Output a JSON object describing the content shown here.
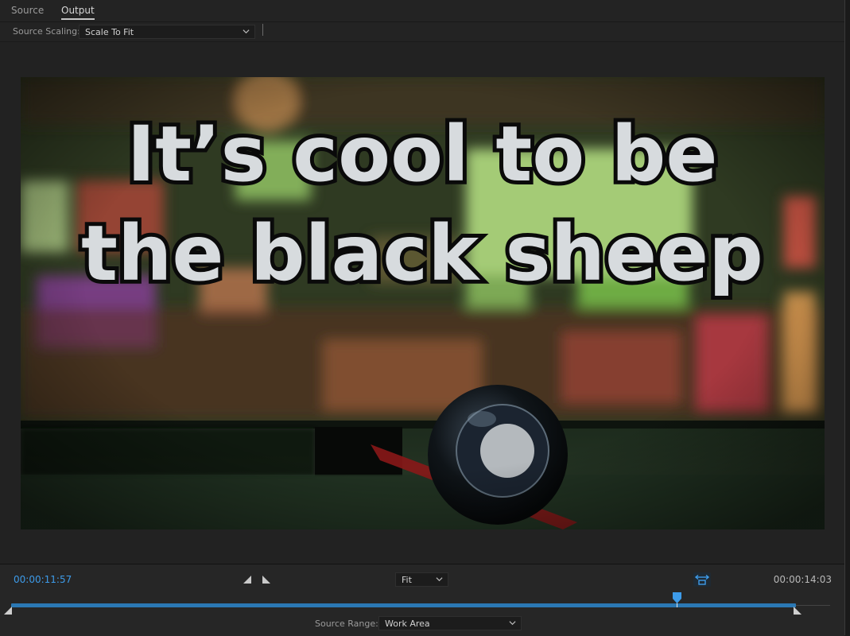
{
  "tabs": [
    {
      "label": "Source",
      "active": false
    },
    {
      "label": "Output",
      "active": true
    }
  ],
  "source_scaling": {
    "label": "Source Scaling:",
    "value": "Scale To Fit"
  },
  "preview": {
    "caption_line1": "It’s cool to be",
    "caption_line2": "the black sheep"
  },
  "timeline": {
    "current_timecode": "00:00:11:57",
    "total_timecode": "00:00:14:03",
    "zoom": "Fit",
    "playhead_fraction": 0.853
  },
  "source_range": {
    "label": "Source Range:",
    "value": "Work Area"
  },
  "colors": {
    "accent": "#3d9be9",
    "track": "#2b78b4",
    "panel": "#232323"
  },
  "icons": [
    "chevron-down-icon",
    "mark-in-icon",
    "mark-out-icon",
    "fit-range-icon",
    "playhead-icon",
    "in-point-icon",
    "out-point-icon"
  ]
}
